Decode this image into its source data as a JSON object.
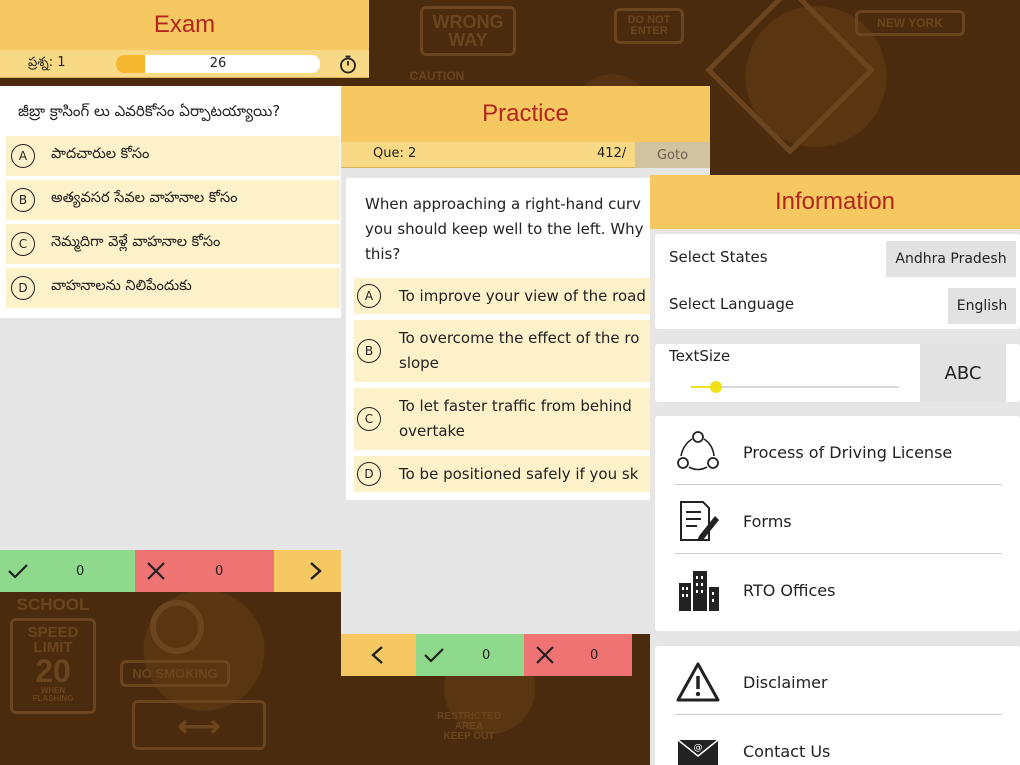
{
  "background_signs": {
    "wrong_way": "WRONG\nWAY",
    "do_not_enter": "DO NOT\nENTER",
    "caution": "CAUTION",
    "new_york": "NEW YORK",
    "school": "SCHOOL",
    "speed_limit": "SPEED\nLIMIT",
    "speed_value": "20",
    "when_flashing": "WHEN\nFLASHING",
    "no_smoking": "NO SMOKING",
    "restricted": "RESTRICTED\nAREA\nKEEP OUT"
  },
  "exam": {
    "title": "Exam",
    "question_label": "ప్రశ్న: 1",
    "progress_value": "26",
    "progress_fraction": 0.14,
    "question": "జీబ్రా క్రాసింగ్ లు ఎవరికోసం ఏర్పాటయ్యాయి?",
    "options": [
      {
        "letter": "A",
        "text": "పాదచారుల కోసం"
      },
      {
        "letter": "B",
        "text": "అత్యవసర సేవల వాహనాల కోసం"
      },
      {
        "letter": "C",
        "text": "నెమ్మదిగా వెళ్లే వాహనాల కోసం"
      },
      {
        "letter": "D",
        "text": "వాహనాలను నిలిపేందుకు"
      }
    ],
    "correct_count": "0",
    "wrong_count": "0"
  },
  "practice": {
    "title": "Practice",
    "question_label": "Que: 2",
    "total": "412/",
    "goto_label": "Goto",
    "question_lines": [
      "When approaching a right-hand curv",
      "you should keep well to the left. Why",
      "this?"
    ],
    "options": [
      {
        "letter": "A",
        "lines": [
          "To improve your view of the road"
        ]
      },
      {
        "letter": "B",
        "lines": [
          "To overcome the effect of the ro",
          "slope"
        ]
      },
      {
        "letter": "C",
        "lines": [
          "To let faster traffic from behind",
          "overtake"
        ]
      },
      {
        "letter": "D",
        "lines": [
          "To be positioned safely if you sk"
        ]
      }
    ],
    "correct_count": "0",
    "wrong_count": "0"
  },
  "information": {
    "title": "Information",
    "select_states_label": "Select States",
    "select_states_value": "Andhra Pradesh",
    "select_language_label": "Select Language",
    "select_language_value": "English",
    "textsize_label": "TextSize",
    "textsize_preview": "ABC",
    "textsize_level": 0.12,
    "menu": [
      {
        "icon": "process-cycle-icon",
        "label": "Process of Driving License"
      },
      {
        "icon": "forms-icon",
        "label": "Forms"
      },
      {
        "icon": "building-icon",
        "label": "RTO Offices"
      }
    ],
    "menu2": [
      {
        "icon": "warning-icon",
        "label": "Disclaimer"
      },
      {
        "icon": "envelope-icon",
        "label": "Contact Us"
      }
    ]
  },
  "colors": {
    "header": "#f5c861",
    "title_red": "#b3261e",
    "option_bg": "#fdf1c9",
    "correct_green": "#8ed98c",
    "wrong_red": "#f07373"
  }
}
